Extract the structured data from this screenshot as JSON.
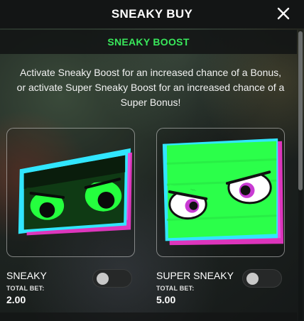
{
  "header": {
    "title": "SNEAKY BUY"
  },
  "section": {
    "title": "SNEAKY BOOST"
  },
  "description": "Activate Sneaky Boost for an increased chance of a Bonus, or activate Super Sneaky Boost for an increased chance of a Super Bonus!",
  "options": [
    {
      "label": "SNEAKY",
      "bet_label": "TOTAL BET:",
      "bet_value": "2.00",
      "toggle_on": false
    },
    {
      "label": "SUPER SNEAKY",
      "bet_label": "TOTAL BET:",
      "bet_value": "5.00",
      "toggle_on": false
    }
  ],
  "colors": {
    "accent_green": "#39e85b",
    "neon_green": "#2bff4a",
    "cyan": "#31e6ff",
    "magenta": "#ff3ad8",
    "dark_green": "#0f3a14"
  },
  "icons": {
    "close": "close-icon"
  }
}
